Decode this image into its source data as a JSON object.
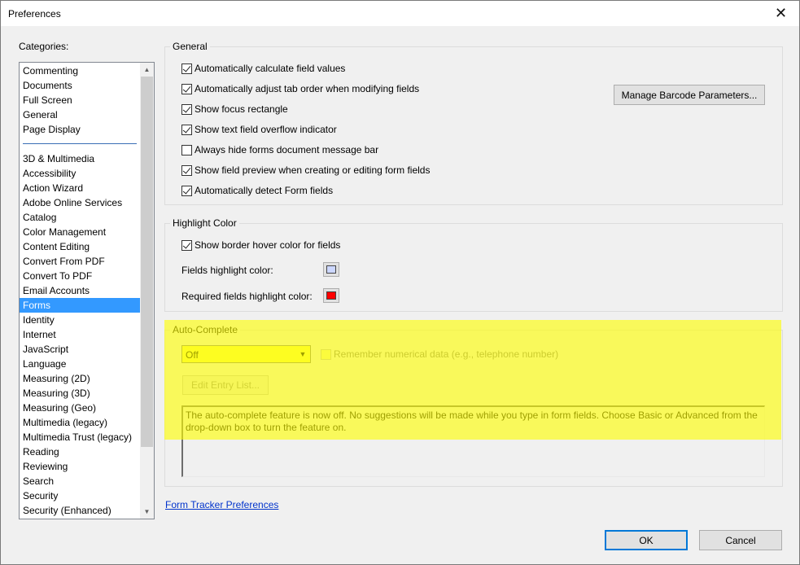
{
  "window": {
    "title": "Preferences",
    "close_symbol": "✕"
  },
  "categories": {
    "label": "Categories:",
    "group1": [
      "Commenting",
      "Documents",
      "Full Screen",
      "General",
      "Page Display"
    ],
    "group2": [
      "3D & Multimedia",
      "Accessibility",
      "Action Wizard",
      "Adobe Online Services",
      "Catalog",
      "Color Management",
      "Content Editing",
      "Convert From PDF",
      "Convert To PDF",
      "Email Accounts",
      "Forms",
      "Identity",
      "Internet",
      "JavaScript",
      "Language",
      "Measuring (2D)",
      "Measuring (3D)",
      "Measuring (Geo)",
      "Multimedia (legacy)",
      "Multimedia Trust (legacy)",
      "Reading",
      "Reviewing",
      "Search",
      "Security",
      "Security (Enhanced)"
    ],
    "selected": "Forms"
  },
  "general": {
    "legend": "General",
    "options": [
      {
        "label": "Automatically calculate field values",
        "checked": true
      },
      {
        "label": "Automatically adjust tab order when modifying fields",
        "checked": true
      },
      {
        "label": "Show focus rectangle",
        "checked": true
      },
      {
        "label": "Show text field overflow indicator",
        "checked": true
      },
      {
        "label": "Always hide forms document message bar",
        "checked": false
      },
      {
        "label": "Show field preview when creating or editing form fields",
        "checked": true
      },
      {
        "label": "Automatically detect Form fields",
        "checked": true
      }
    ],
    "barcode_button": "Manage Barcode Parameters..."
  },
  "highlight": {
    "legend": "Highlight Color",
    "border_hover_label": "Show border hover color for fields",
    "border_hover_checked": true,
    "fields_label": "Fields highlight color:",
    "fields_color": "#ccd7ff",
    "required_label": "Required fields highlight color:",
    "required_color": "#ff0000"
  },
  "autocomplete": {
    "legend": "Auto-Complete",
    "mode": "Off",
    "remember_label": "Remember numerical data (e.g., telephone number)",
    "remember_checked": false,
    "edit_button": "Edit Entry List...",
    "description": "The auto-complete feature is now off. No suggestions will be made while you type in form fields. Choose Basic or Advanced from the drop-down box to turn the feature on."
  },
  "link": "Form Tracker Preferences",
  "buttons": {
    "ok": "OK",
    "cancel": "Cancel"
  }
}
